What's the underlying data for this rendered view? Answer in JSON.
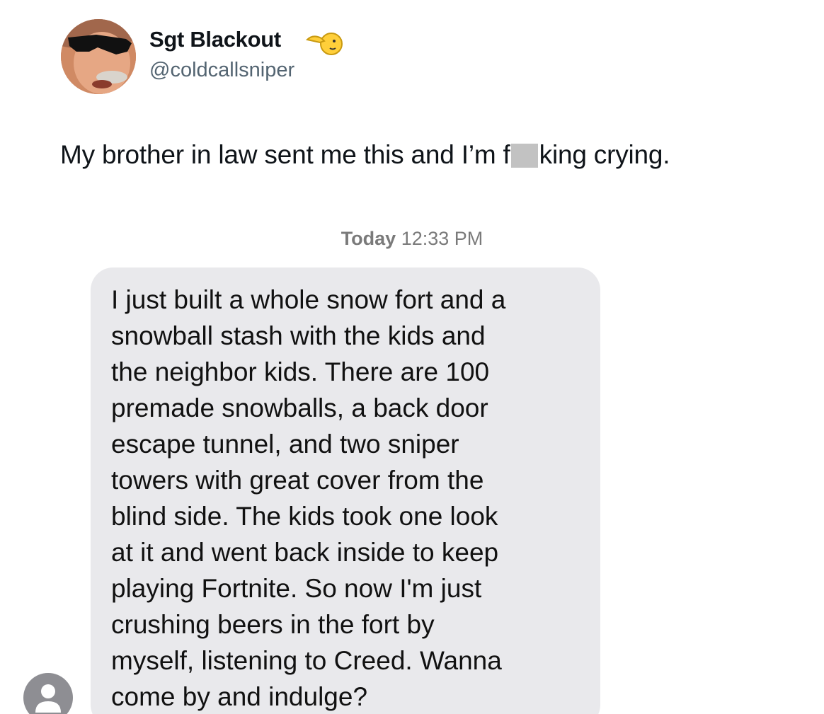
{
  "post": {
    "author": {
      "display_name": "Sgt Blackout",
      "handle": "@coldcallsniper",
      "avatar_icon": "profile-photo-man-sunglasses",
      "badge_icon": "pointing-hand-emoji-icon"
    },
    "text_before_censor": "My brother in law sent me this and I’m f",
    "text_after_censor": "king crying."
  },
  "message": {
    "timestamp_day": "Today",
    "timestamp_time": "12:33 PM",
    "sender_avatar_icon": "person-silhouette-icon",
    "bubble_text": "I just built a whole snow fort and a\nsnowball stash with the kids and\nthe neighbor kids. There are 100\npremade snowballs, a back door\nescape tunnel, and two sniper\ntowers with great cover from the\nblind side. The kids took one look\nat it and went back inside to keep\nplaying Fortnite. So now I'm just\ncrushing beers in the fort by\nmyself, listening to Creed. Wanna\ncome by and indulge?"
  },
  "colors": {
    "background": "#ffffff",
    "handle_gray": "#536471",
    "bubble_gray": "#e9e9ec",
    "timestamp_gray": "#7a7a7a",
    "censor_gray": "#c2c2c2"
  }
}
